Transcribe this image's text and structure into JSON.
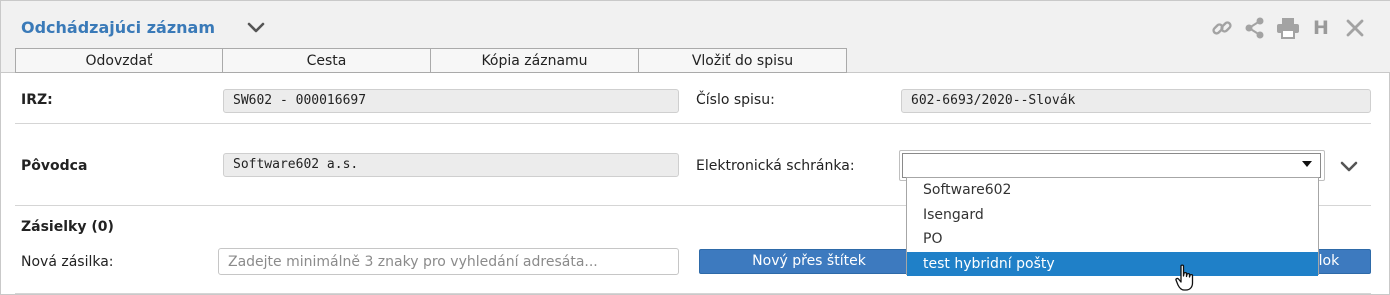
{
  "header": {
    "title": "Odchádzajúci záznam",
    "tools": {
      "link_icon": "link-icon",
      "share_icon": "share-icon",
      "print_icon": "printer-icon",
      "history_label": "H",
      "close_icon": "close-icon"
    }
  },
  "tabs": [
    {
      "label": "Odovzdať"
    },
    {
      "label": "Cesta"
    },
    {
      "label": "Kópia záznamu"
    },
    {
      "label": "Vložiť do spisu"
    }
  ],
  "form": {
    "irz_label": "IRZ:",
    "irz_value": "SW602 - 000016697",
    "cislo_spisu_label": "Číslo spisu:",
    "cislo_spisu_value": "602-6693/2020--Slovák",
    "povodca_label": "Pôvodca",
    "povodca_value": "Software602 a.s.",
    "schranka_label": "Elektronická schránka:",
    "schranka_value": ""
  },
  "dropdown": {
    "options": [
      {
        "label": "Software602"
      },
      {
        "label": "Isengard"
      },
      {
        "label": "PO"
      },
      {
        "label": "test hybridní pošty"
      }
    ],
    "highlighted_index": 3
  },
  "zasielky": {
    "heading": "Zásielky (0)",
    "nova_label": "Nová zásilka:",
    "search_placeholder": "Zadejte minimálně 3 znaky pro vyhledání adresáta...",
    "btn_novy_label": "Nový přes štítek",
    "btn_right_label": "elok"
  },
  "colors": {
    "accent": "#3a7ab8",
    "button": "#3d7abf",
    "selected_option": "#1f80c8",
    "header_bg": "#f1f1f1"
  }
}
